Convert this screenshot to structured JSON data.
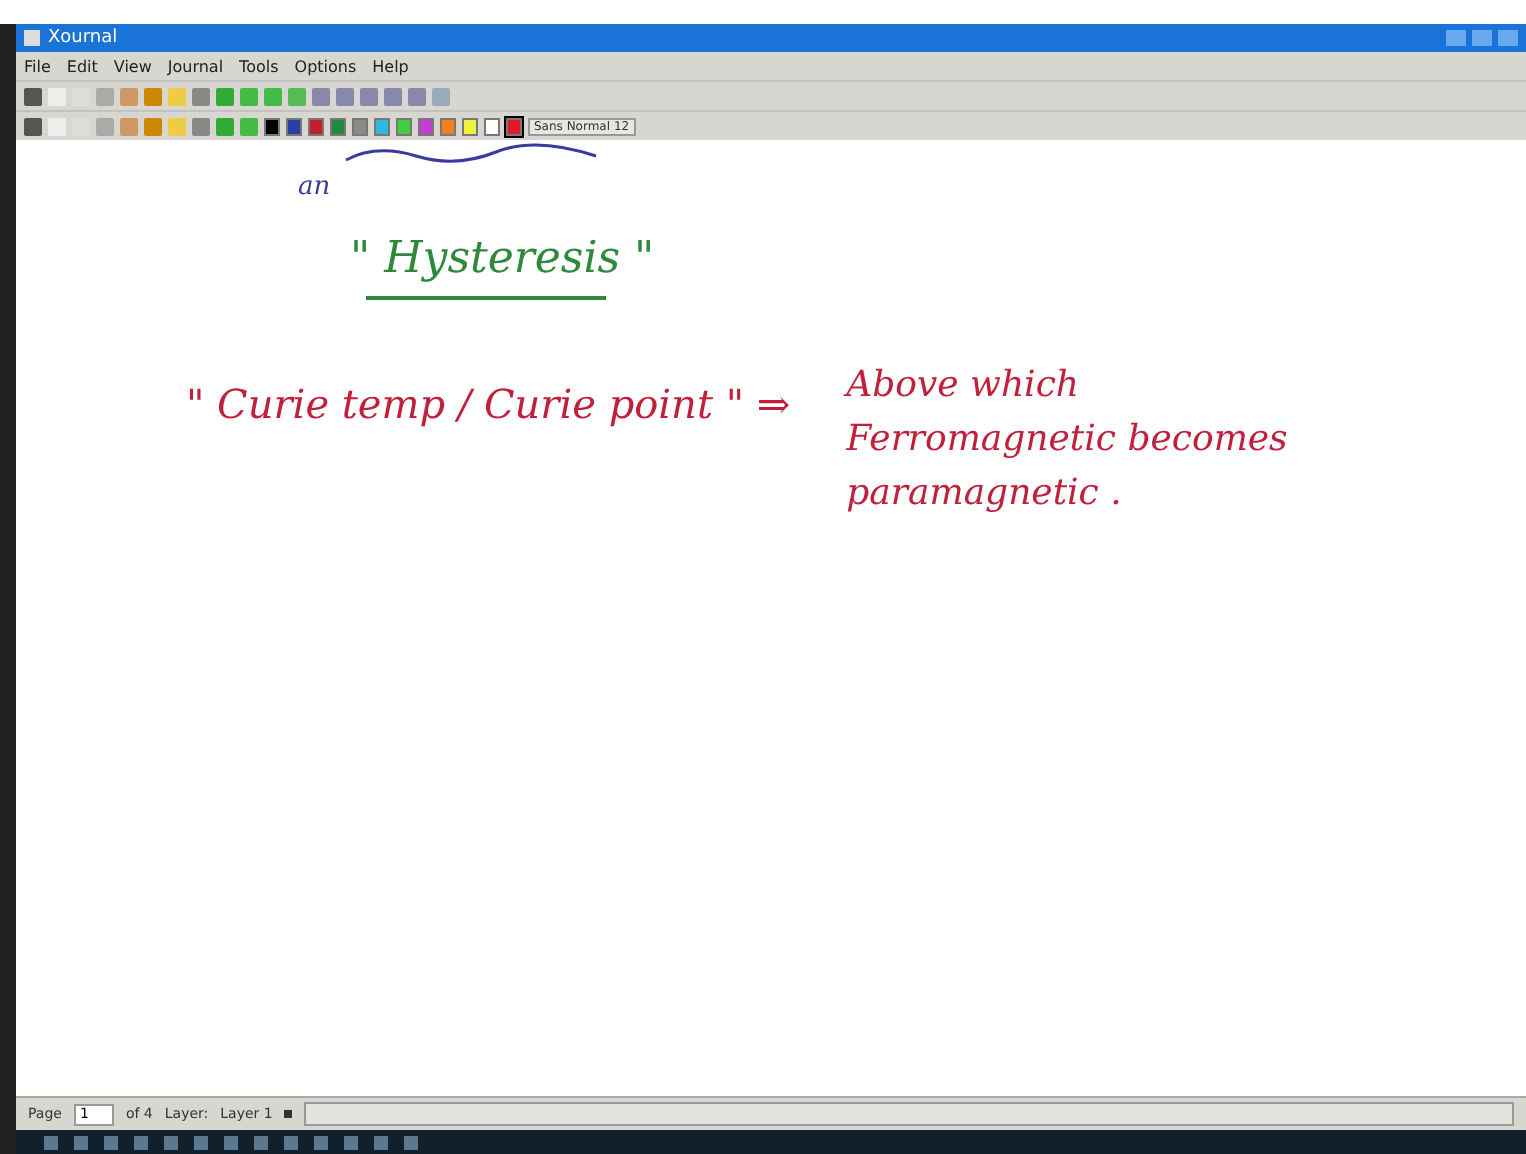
{
  "window": {
    "title": "Xournal"
  },
  "menu": [
    "File",
    "Edit",
    "View",
    "Journal",
    "Tools",
    "Options",
    "Help"
  ],
  "palette": [
    {
      "color": "#000000",
      "selected": false
    },
    {
      "color": "#2a3ea8",
      "selected": false
    },
    {
      "color": "#c0202a",
      "selected": false
    },
    {
      "color": "#208a3a",
      "selected": false
    },
    {
      "color": "#8a8a8a",
      "selected": false
    },
    {
      "color": "#30b8e0",
      "selected": false
    },
    {
      "color": "#40d040",
      "selected": false
    },
    {
      "color": "#c040d0",
      "selected": false
    },
    {
      "color": "#f08020",
      "selected": false
    },
    {
      "color": "#f0f040",
      "selected": false
    },
    {
      "color": "#ffffff",
      "selected": false
    },
    {
      "color": "#e01828",
      "selected": true
    }
  ],
  "font_button": "Sans Normal 12",
  "notes": [
    {
      "text": "an",
      "color": "#3a3aa0",
      "kind": "small"
    },
    {
      "text": "\" Hysteresis \"",
      "color": "#2e8a3a",
      "kind": "heading"
    },
    {
      "text": "\" Curie temp / Curie point \" ⇒",
      "color": "#c0203a",
      "kind": "line"
    },
    {
      "text": "Above which",
      "color": "#c0203a",
      "kind": "side"
    },
    {
      "text": "Ferromagnetic becomes",
      "color": "#c0203a",
      "kind": "side"
    },
    {
      "text": "paramagnetic .",
      "color": "#c0203a",
      "kind": "side"
    }
  ],
  "status_bar": {
    "page_label": "Page",
    "page_value": "1",
    "of_label": "of 4",
    "layer_label": "Layer:",
    "layer_value": "Layer 1"
  }
}
